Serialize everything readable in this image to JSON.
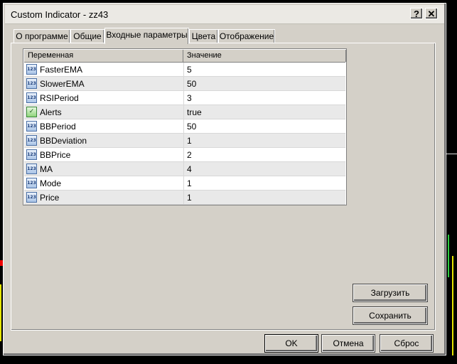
{
  "window": {
    "title": "Custom Indicator - zz43"
  },
  "titlebar": {
    "help_label": "?",
    "close_label": "✕"
  },
  "tabs": [
    {
      "label": "О программе"
    },
    {
      "label": "Общие"
    },
    {
      "label": "Входные параметры"
    },
    {
      "label": "Цвета"
    },
    {
      "label": "Отображение"
    }
  ],
  "active_tab": "Входные параметры",
  "table": {
    "headers": {
      "name": "Переменная",
      "value": "Значение"
    },
    "rows": [
      {
        "name": "FasterEMA",
        "value": "5",
        "icon": "123"
      },
      {
        "name": "SlowerEMA",
        "value": "50",
        "icon": "123"
      },
      {
        "name": "RSIPeriod",
        "value": "3",
        "icon": "123"
      },
      {
        "name": "Alerts",
        "value": "true",
        "icon": "bool"
      },
      {
        "name": "BBPeriod",
        "value": "50",
        "icon": "123"
      },
      {
        "name": "BBDeviation",
        "value": "1",
        "icon": "123"
      },
      {
        "name": "BBPrice",
        "value": "2",
        "icon": "123"
      },
      {
        "name": "MA",
        "value": "4",
        "icon": "123"
      },
      {
        "name": "Mode",
        "value": "1",
        "icon": "123"
      },
      {
        "name": "Price",
        "value": "1",
        "icon": "123"
      }
    ]
  },
  "side_buttons": {
    "load": "Загрузить",
    "save": "Сохранить"
  },
  "footer": {
    "ok": "OK",
    "cancel": "Отмена",
    "reset": "Сброс"
  },
  "colors": {
    "dialog_bg": "#d4d0c8",
    "row_alt": "#e9e9e9",
    "icon_blue": "#a9c3e6",
    "icon_green": "#8fd47a"
  }
}
